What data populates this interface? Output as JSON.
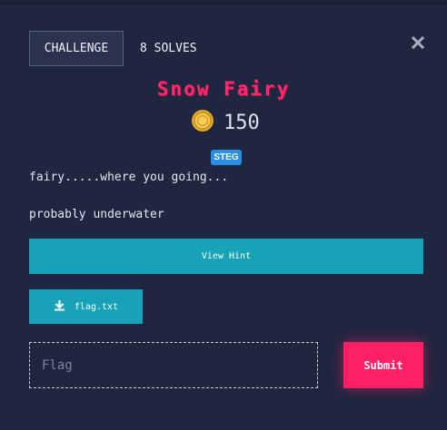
{
  "tabs": {
    "challenge_label": "CHALLENGE",
    "solves_label": "8 SOLVES"
  },
  "challenge": {
    "name": "Snow Fairy",
    "points": "150",
    "category_tag": "STEG",
    "description_lines": [
      "fairy.....where you going...",
      "probably underwater"
    ]
  },
  "actions": {
    "hint_label": "View Hint",
    "file_label": "flag.txt",
    "flag_placeholder": "Flag",
    "flag_value": "",
    "submit_label": "Submit"
  },
  "icons": {
    "close": "close-icon",
    "coin": "coin-icon",
    "download": "download-icon"
  },
  "colors": {
    "background": "#1f2640",
    "title": "#ff2a6d",
    "teal": "#17a2b8",
    "submit": "#ff1f64",
    "tag": "#2a8ee3"
  }
}
